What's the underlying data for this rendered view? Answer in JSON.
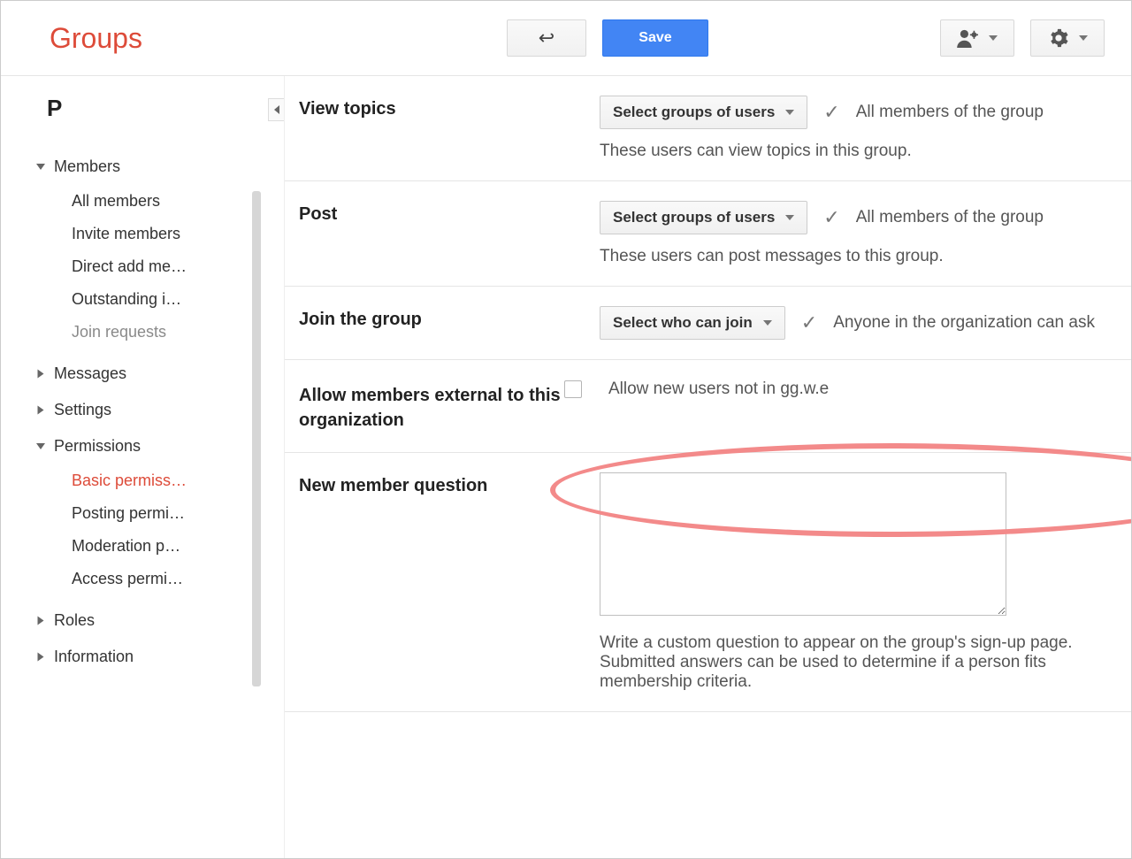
{
  "brand": "Groups",
  "header": {
    "save_label": "Save"
  },
  "sidebar": {
    "title_letter": "P",
    "groups": [
      {
        "label": "Members",
        "expanded": true,
        "items": [
          {
            "label": "All members"
          },
          {
            "label": "Invite members"
          },
          {
            "label": "Direct add me…"
          },
          {
            "label": "Outstanding i…"
          },
          {
            "label": "Join requests",
            "muted": true
          }
        ]
      },
      {
        "label": "Messages",
        "expanded": false
      },
      {
        "label": "Settings",
        "expanded": false
      },
      {
        "label": "Permissions",
        "expanded": true,
        "items": [
          {
            "label": "Basic permiss…",
            "active": true
          },
          {
            "label": "Posting permi…"
          },
          {
            "label": "Moderation p…"
          },
          {
            "label": "Access permi…"
          }
        ]
      },
      {
        "label": "Roles",
        "expanded": false
      },
      {
        "label": "Information",
        "expanded": false
      }
    ]
  },
  "sections": {
    "view_topics": {
      "label": "View topics",
      "dropdown": "Select groups of users",
      "selected": "All members of the group",
      "help": "These users can view topics in this group."
    },
    "post": {
      "label": "Post",
      "dropdown": "Select groups of users",
      "selected": "All members of the group",
      "help": "These users can post messages to this group."
    },
    "join": {
      "label": "Join the group",
      "dropdown": "Select who can join",
      "selected": "Anyone in the organization can ask"
    },
    "external": {
      "label": "Allow members external to this organization",
      "checkbox_label": "Allow new users not in gg.w.e"
    },
    "question": {
      "label": "New member question",
      "help": "Write a custom question to appear on the group's sign-up page. Submitted answers can be used to determine if a person fits membership criteria."
    }
  }
}
